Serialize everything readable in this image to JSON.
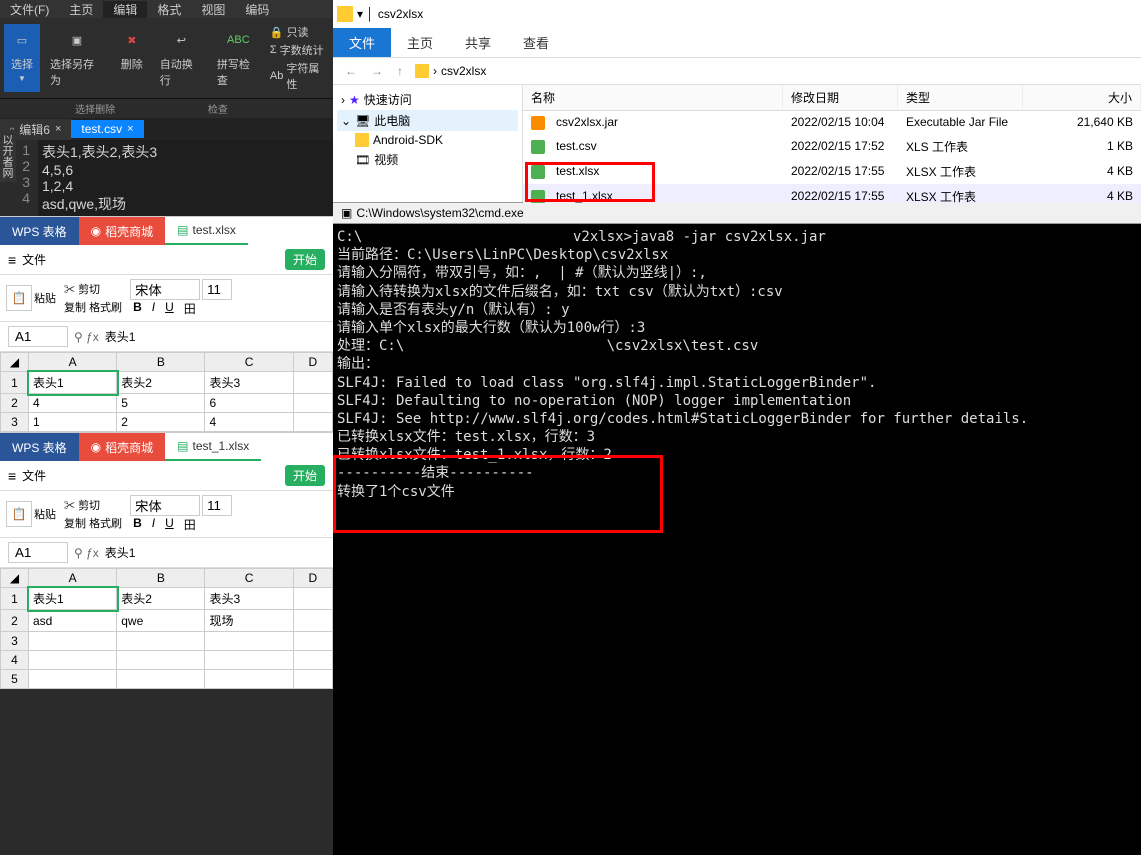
{
  "editor": {
    "menus": [
      "文件(F)",
      "主页",
      "编辑",
      "格式",
      "视图",
      "编码"
    ],
    "ribbon": {
      "select": "选择",
      "saveAs": "选择另存为",
      "delete": "删除",
      "selDel": "选择删除",
      "autowrap": "自动换行",
      "spell": "拼写检查",
      "spellIcon": "ABC",
      "readonly": "只读",
      "wordcount": "字数统计",
      "charprops": "字符属性",
      "checkLabel": "检查"
    },
    "tabs": {
      "tab1": "编辑6",
      "tab2": "test.csv"
    },
    "code": {
      "l1": "表头1,表头2,表头3",
      "l2": "4,5,6",
      "l3": "1,2,4",
      "l4": "asd,qwe,现场"
    },
    "sideCollapse": "以开者网"
  },
  "wps1": {
    "tab1": "WPS 表格",
    "tab2": "稻壳商城",
    "tab3": "test.xlsx",
    "fileBtn": "文件",
    "startBtn": "开始",
    "paste": "粘贴",
    "cut": "剪切",
    "copy": "复制",
    "fmtBrush": "格式刷",
    "font": "宋体",
    "size": "11",
    "cellRef": "A1",
    "fxVal": "表头1",
    "h": {
      "a": "A",
      "b": "B",
      "c": "C",
      "d": "D"
    },
    "r1": {
      "a": "表头1",
      "b": "表头2",
      "c": "表头3"
    },
    "r2": {
      "a": "4",
      "b": "5",
      "c": "6"
    },
    "r3": {
      "a": "1",
      "b": "2",
      "c": "4"
    }
  },
  "wps2": {
    "tab1": "WPS 表格",
    "tab2": "稻壳商城",
    "tab3": "test_1.xlsx",
    "fileBtn": "文件",
    "startBtn": "开始",
    "paste": "粘贴",
    "cut": "剪切",
    "copy": "复制",
    "fmtBrush": "格式刷",
    "font": "宋体",
    "size": "11",
    "cellRef": "A1",
    "fxVal": "表头1",
    "h": {
      "a": "A",
      "b": "B",
      "c": "C",
      "d": "D"
    },
    "r1": {
      "a": "表头1",
      "b": "表头2",
      "c": "表头3"
    },
    "r2": {
      "a": "asd",
      "b": "qwe",
      "c": "现场"
    }
  },
  "explorer": {
    "title": "csv2xlsx",
    "ribbon": {
      "file": "文件",
      "home": "主页",
      "share": "共享",
      "view": "查看"
    },
    "crumb": "csv2xlsx",
    "tree": {
      "quick": "快速访问",
      "pc": "此电脑",
      "sdk": "Android-SDK",
      "video": "视频"
    },
    "cols": {
      "name": "名称",
      "date": "修改日期",
      "type": "类型",
      "size": "大小"
    },
    "rows": [
      {
        "name": "csv2xlsx.jar",
        "date": "2022/02/15 10:04",
        "type": "Executable Jar File",
        "size": "21,640 KB"
      },
      {
        "name": "test.csv",
        "date": "2022/02/15 17:52",
        "type": "XLS 工作表",
        "size": "1 KB"
      },
      {
        "name": "test.xlsx",
        "date": "2022/02/15 17:55",
        "type": "XLSX 工作表",
        "size": "4 KB"
      },
      {
        "name": "test_1.xlsx",
        "date": "2022/02/15 17:55",
        "type": "XLSX 工作表",
        "size": "4 KB"
      }
    ]
  },
  "cmd": {
    "title": "C:\\Windows\\system32\\cmd.exe",
    "body": "C:\\                         v2xlsx>java8 -jar csv2xlsx.jar\n当前路径：C:\\Users\\LinPC\\Desktop\\csv2xlsx\n请输入分隔符，带双引号，如：,  | #（默认为竖线|）:,\n请输入待转换为xlsx的文件后缀名，如：txt csv（默认为txt）:csv\n请输入是否有表头y/n（默认有）: y\n请输入单个xlsx的最大行数（默认为100w行）:3\n处理：C:\\                        \\csv2xlsx\\test.csv\n输出：\nSLF4J: Failed to load class \"org.slf4j.impl.StaticLoggerBinder\".\nSLF4J: Defaulting to no-operation (NOP) logger implementation\nSLF4J: See http://www.slf4j.org/codes.html#StaticLoggerBinder for further details.\n已转换xlsx文件：test.xlsx，行数：3\n已转换xlsx文件：test_1.xlsx，行数：2\n----------结束----------\n转换了1个csv文件"
  }
}
